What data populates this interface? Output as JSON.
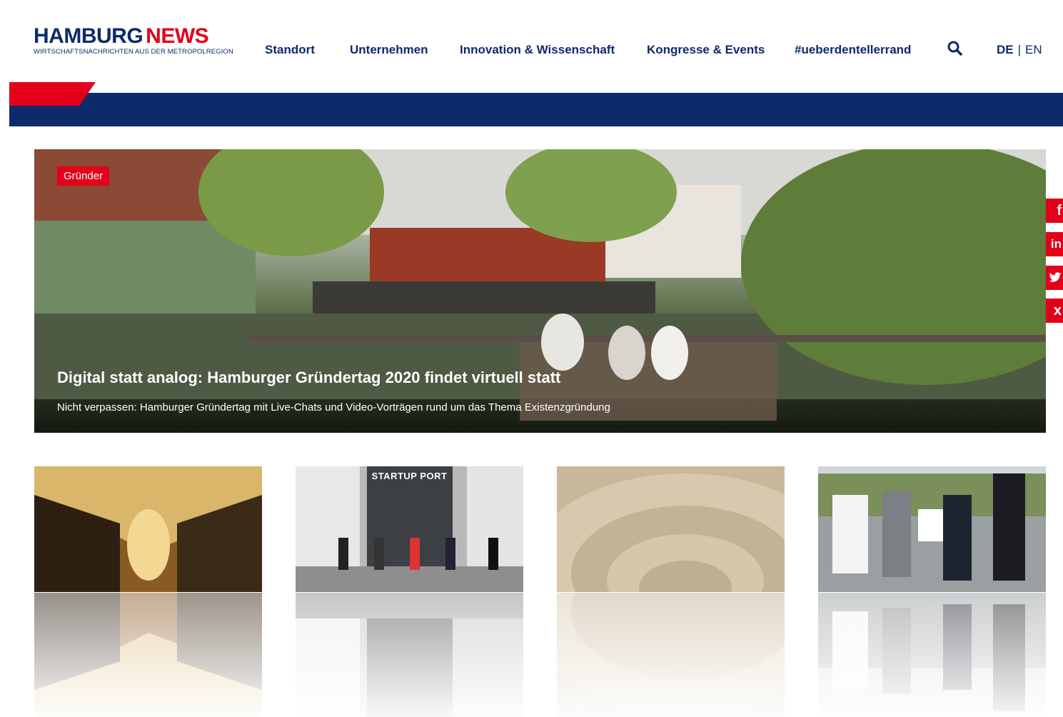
{
  "logo": {
    "part1": "HAMBURG",
    "part2": "NEWS",
    "tagline": "WIRTSCHAFTSNACHRICHTEN AUS DER METROPOLREGION"
  },
  "nav": [
    {
      "label": "Standort"
    },
    {
      "label": "Unternehmen"
    },
    {
      "label": "Innovation & Wissenschaft"
    },
    {
      "label": "Kongresse & Events"
    },
    {
      "label": "#ueberdentellerrand"
    }
  ],
  "search": {
    "icon": "search-icon"
  },
  "lang": {
    "de": "DE",
    "separator": "|",
    "en": "EN"
  },
  "hero": {
    "tag": "Gründer",
    "title": "Digital statt analog: Hamburger Gründertag 2020 findet virtuell statt",
    "subtitle": "Nicht verpassen: Hamburger Gründertag mit Live-Chats und Video-Vorträgen rund um das Thema Existenzgründung"
  },
  "social": [
    {
      "icon": "facebook-icon",
      "glyph": "f"
    },
    {
      "icon": "linkedin-icon",
      "glyph": "in"
    },
    {
      "icon": "twitter-icon",
      "glyph": "t"
    },
    {
      "icon": "xing-icon",
      "glyph": "x"
    }
  ],
  "cards": [
    {
      "caption": ""
    },
    {
      "caption": "STARTUP PORT"
    },
    {
      "caption": ""
    },
    {
      "caption": ""
    }
  ],
  "colors": {
    "navy": "#0d2a6b",
    "red": "#e2001a"
  }
}
